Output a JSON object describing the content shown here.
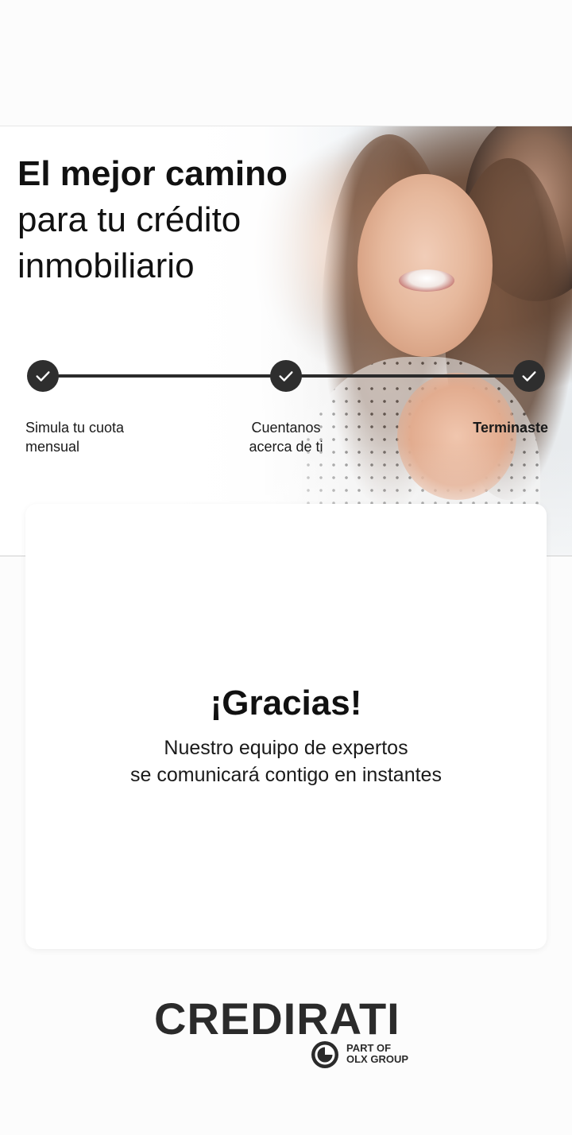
{
  "hero": {
    "title_strong": "El mejor camino",
    "title_line2": "para tu crédito",
    "title_line3": "inmobiliario"
  },
  "steps": [
    {
      "label_line1": "Simula tu cuota",
      "label_line2": "mensual",
      "status": "completed"
    },
    {
      "label_line1": "Cuentanos",
      "label_line2": "acerca de ti",
      "status": "completed"
    },
    {
      "label_line1": "Terminaste",
      "label_line2": "",
      "status": "completed"
    }
  ],
  "card": {
    "heading": "¡Gracias!",
    "message_line1": "Nuestro equipo de expertos",
    "message_line2": "se comunicará contigo en instantes"
  },
  "footer": {
    "brand": "CREDIRATI",
    "group_line1": "PART OF",
    "group_line2": "OLX GROUP"
  },
  "colors": {
    "step_dot": "#2e2e2e",
    "logo": "#2b2b2b",
    "background": "#fcfcfc",
    "card": "#ffffff"
  },
  "icons": [
    "check-icon",
    "olx-group-icon"
  ]
}
